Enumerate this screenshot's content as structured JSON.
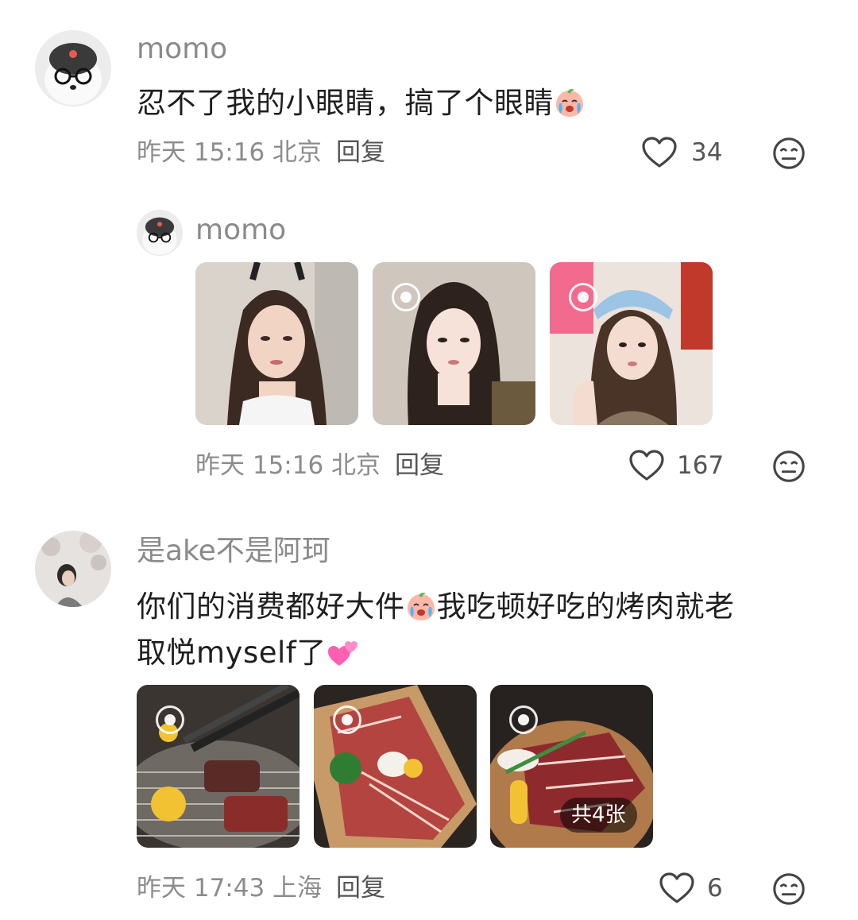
{
  "comments": [
    {
      "username": "momo",
      "text": "忍不了我的小眼睛，搞了个眼睛",
      "time": "昨天 15:16 北京",
      "reply": "回复",
      "likes": "34"
    },
    {
      "username": "momo",
      "time": "昨天 15:16 北京",
      "reply": "回复",
      "likes": "167",
      "images": [
        "girl-photo-1",
        "girl-photo-2",
        "girl-photo-3"
      ]
    },
    {
      "username": "是ake不是阿珂",
      "text_line1a": "你们的消费都好大件",
      "text_line1b": "我吃顿好吃的烤肉就老",
      "text_line2": "取悦myself了",
      "time": "昨天 17:43 上海",
      "reply": "回复",
      "likes": "6",
      "images": [
        "bbq-photo-1",
        "bbq-photo-2",
        "bbq-photo-3"
      ],
      "image_count_badge": "共4张"
    }
  ],
  "icons": {
    "like": "heart-icon",
    "dislike": "meh-face-icon",
    "live": "live-photo-icon",
    "emoji_cry": "crying-peach-emoji",
    "emoji_hearts": "two-hearts-emoji"
  },
  "colors": {
    "meta": "#8c8c8c",
    "text": "#1f1f1f",
    "username": "#8a8a8a"
  }
}
